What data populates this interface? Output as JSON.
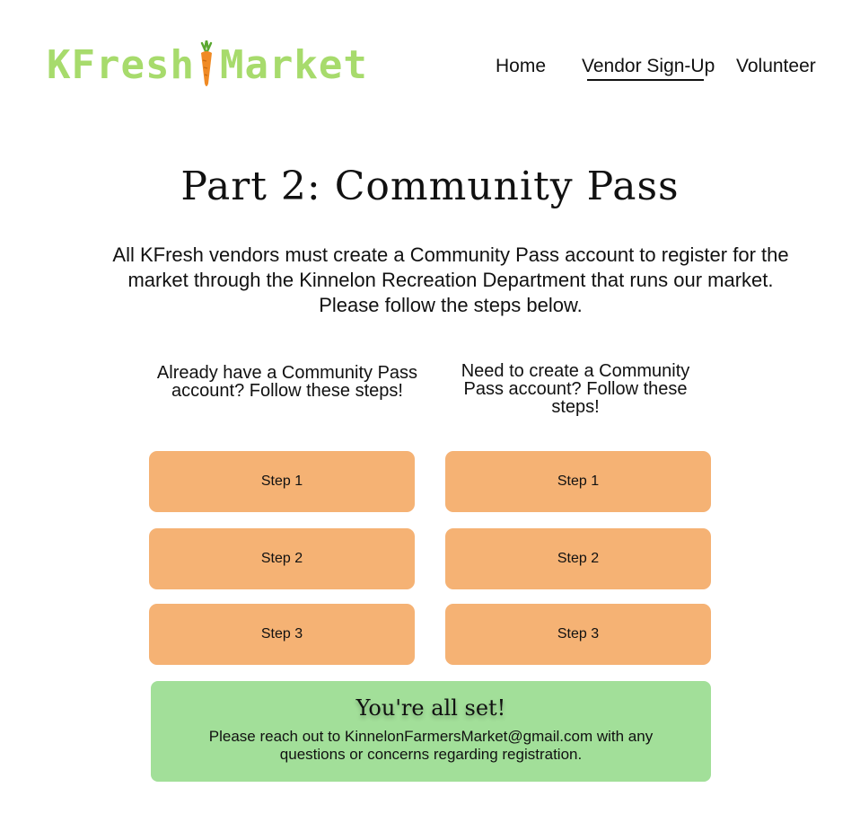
{
  "header": {
    "logo_left": "KFresh",
    "logo_right": "Market",
    "nav": {
      "home": "Home",
      "vendor_signup": "Vendor Sign-Up",
      "volunteer": "Volunteer"
    }
  },
  "main": {
    "title": "Part 2: Community Pass",
    "intro": "All KFresh vendors must create a Community Pass account to register for the market through the Kinnelon Recreation Department that runs our market.  Please follow the steps below.",
    "left_column": {
      "heading": "Already have a Community Pass account? Follow these steps!",
      "steps": [
        "Step 1",
        "Step 2",
        "Step 3"
      ]
    },
    "right_column": {
      "heading": "Need to create a Community Pass account? Follow these steps!",
      "steps": [
        "Step 1",
        "Step 2",
        "Step 3"
      ]
    },
    "success": {
      "title": "You're all set!",
      "text_before": "Please reach out to ",
      "email": "KinnelonFarmersMarket@gmail.com",
      "text_after": " with any questions or concerns regarding registration."
    }
  },
  "colors": {
    "logo_green": "#a7db6c",
    "step_button": "#f5b274",
    "success_panel": "#a2df99",
    "carrot_orange": "#f08a24",
    "carrot_leaf": "#5aa72f"
  },
  "icons": {
    "logo_mark": "carrot-icon"
  }
}
